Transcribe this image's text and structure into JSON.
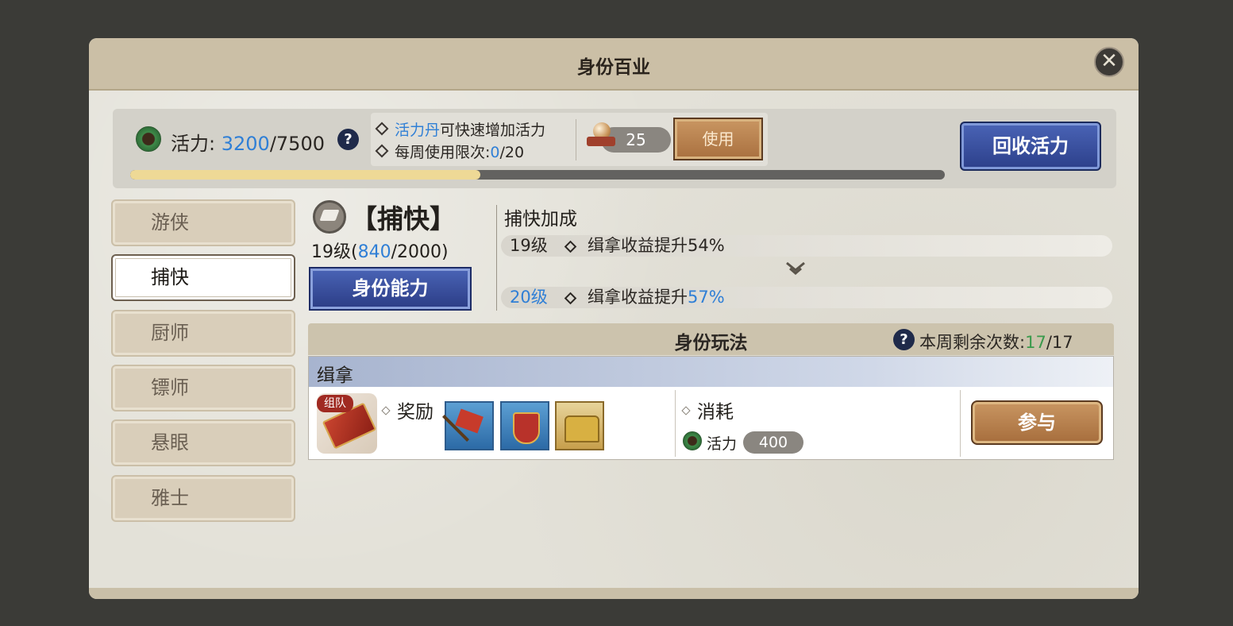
{
  "window": {
    "title": "身份百业"
  },
  "vitality": {
    "label": "活力:",
    "current": "3200",
    "max": "/7500",
    "progress_fraction": 0.43,
    "tip_item": "活力丹",
    "tip_text": "可快速增加活力",
    "weekly_limit_label": "每周使用限次:",
    "weekly_used": "0",
    "weekly_max": "/20",
    "item_count": "25",
    "use_label": "使用",
    "recycle_label": "回收活力"
  },
  "tabs": [
    {
      "label": "游侠",
      "active": false
    },
    {
      "label": "捕快",
      "active": true
    },
    {
      "label": "厨师",
      "active": false
    },
    {
      "label": "镖师",
      "active": false
    },
    {
      "label": "悬眼",
      "active": false
    },
    {
      "label": "雅士",
      "active": false
    }
  ],
  "role": {
    "name": "【捕快】",
    "level_prefix": "19级(",
    "exp_current": "840",
    "exp_suffix": "/2000)",
    "ability_button": "身份能力"
  },
  "bonus": {
    "title": "捕快加成",
    "current_level": "19级",
    "current_text": "缉拿收益提升54%",
    "next_level": "20级",
    "next_text_prefix": "缉拿收益提升",
    "next_value": "57%"
  },
  "modes": {
    "title": "身份玩法",
    "remain_label": "本周剩余次数:",
    "remain_current": "17",
    "remain_max": "/17"
  },
  "activity": {
    "name": "缉拿",
    "team_badge": "组队",
    "reward_label": "奖励",
    "rewards": [
      "flag-icon",
      "shield-icon",
      "chest-icon"
    ],
    "cost_label": "消耗",
    "cost_type": "活力",
    "cost_value": "400",
    "join_label": "参与"
  },
  "colors": {
    "accent_blue": "#2f7fd6",
    "remain_green": "#3a9a4c",
    "button_blue": "#2c3f8a",
    "button_brown": "#a9703f"
  }
}
